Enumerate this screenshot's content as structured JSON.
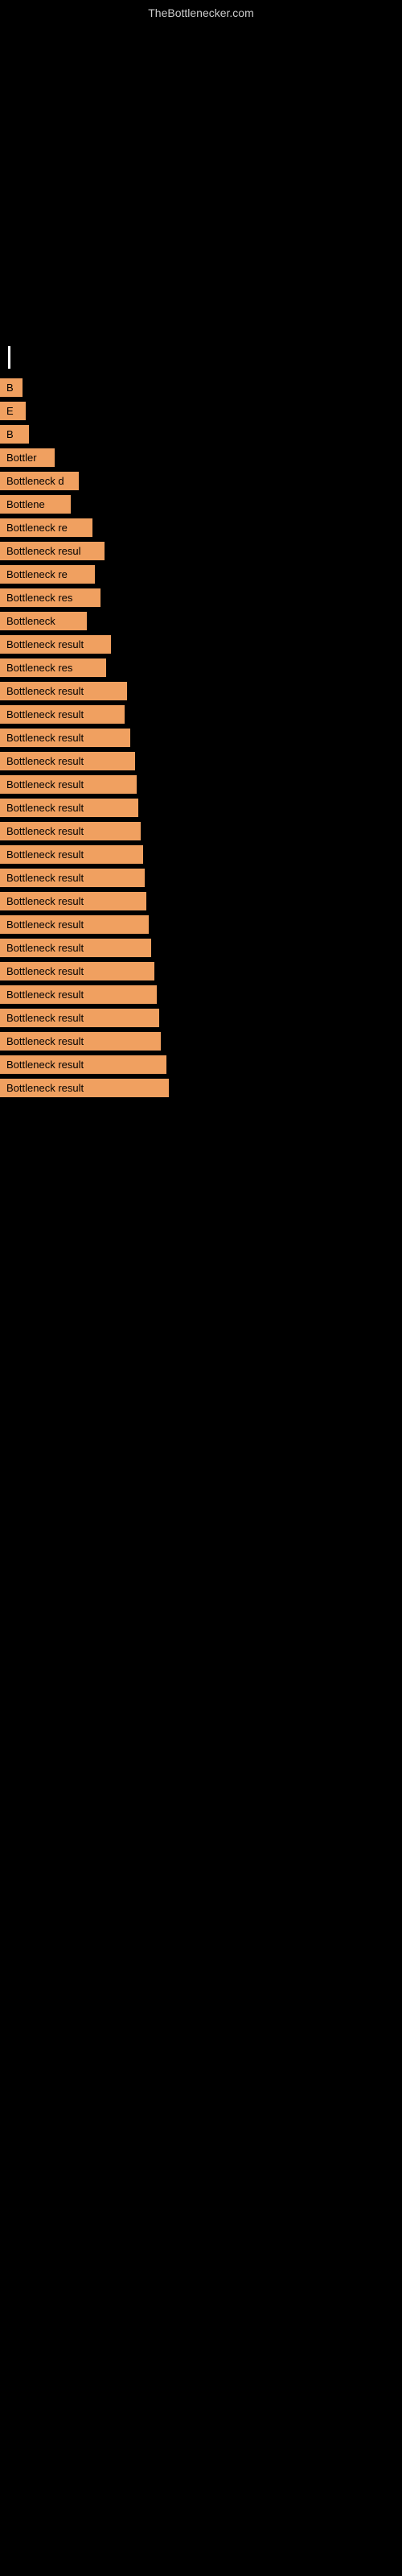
{
  "site": {
    "title": "TheBottlenecker.com"
  },
  "items": [
    {
      "id": 1,
      "label": "B",
      "size_class": "size-xs"
    },
    {
      "id": 2,
      "label": "E",
      "size_class": "size-sm1"
    },
    {
      "id": 3,
      "label": "B",
      "size_class": "size-sm2"
    },
    {
      "id": 4,
      "label": "Bottler",
      "size_class": "size-md1"
    },
    {
      "id": 5,
      "label": "Bottleneck d",
      "size_class": "size-md2"
    },
    {
      "id": 6,
      "label": "Bottlene",
      "size_class": "size-md3"
    },
    {
      "id": 7,
      "label": "Bottleneck re",
      "size_class": "size-md4"
    },
    {
      "id": 8,
      "label": "Bottleneck resul",
      "size_class": "size-md5"
    },
    {
      "id": 9,
      "label": "Bottleneck re",
      "size_class": "size-md6"
    },
    {
      "id": 10,
      "label": "Bottleneck res",
      "size_class": "size-md7"
    },
    {
      "id": 11,
      "label": "Bottleneck",
      "size_class": "size-lg1"
    },
    {
      "id": 12,
      "label": "Bottleneck result",
      "size_class": "size-lg2"
    },
    {
      "id": 13,
      "label": "Bottleneck res",
      "size_class": "size-lg3"
    },
    {
      "id": 14,
      "label": "Bottleneck result",
      "size_class": "size-full1"
    },
    {
      "id": 15,
      "label": "Bottleneck result",
      "size_class": "size-full2"
    },
    {
      "id": 16,
      "label": "Bottleneck result",
      "size_class": "size-full3"
    },
    {
      "id": 17,
      "label": "Bottleneck result",
      "size_class": "size-full4"
    },
    {
      "id": 18,
      "label": "Bottleneck result",
      "size_class": "size-full5"
    },
    {
      "id": 19,
      "label": "Bottleneck result",
      "size_class": "size-full6"
    },
    {
      "id": 20,
      "label": "Bottleneck result",
      "size_class": "size-full7"
    },
    {
      "id": 21,
      "label": "Bottleneck result",
      "size_class": "size-full8"
    },
    {
      "id": 22,
      "label": "Bottleneck result",
      "size_class": "size-full9"
    },
    {
      "id": 23,
      "label": "Bottleneck result",
      "size_class": "size-full10"
    },
    {
      "id": 24,
      "label": "Bottleneck result",
      "size_class": "size-full11"
    },
    {
      "id": 25,
      "label": "Bottleneck result",
      "size_class": "size-full12"
    },
    {
      "id": 26,
      "label": "Bottleneck result",
      "size_class": "size-full13"
    },
    {
      "id": 27,
      "label": "Bottleneck result",
      "size_class": "size-full14"
    },
    {
      "id": 28,
      "label": "Bottleneck result",
      "size_class": "size-full15"
    },
    {
      "id": 29,
      "label": "Bottleneck result",
      "size_class": "size-full16"
    },
    {
      "id": 30,
      "label": "Bottleneck result",
      "size_class": "size-full17"
    },
    {
      "id": 31,
      "label": "Bottleneck result",
      "size_class": "size-full18"
    }
  ]
}
